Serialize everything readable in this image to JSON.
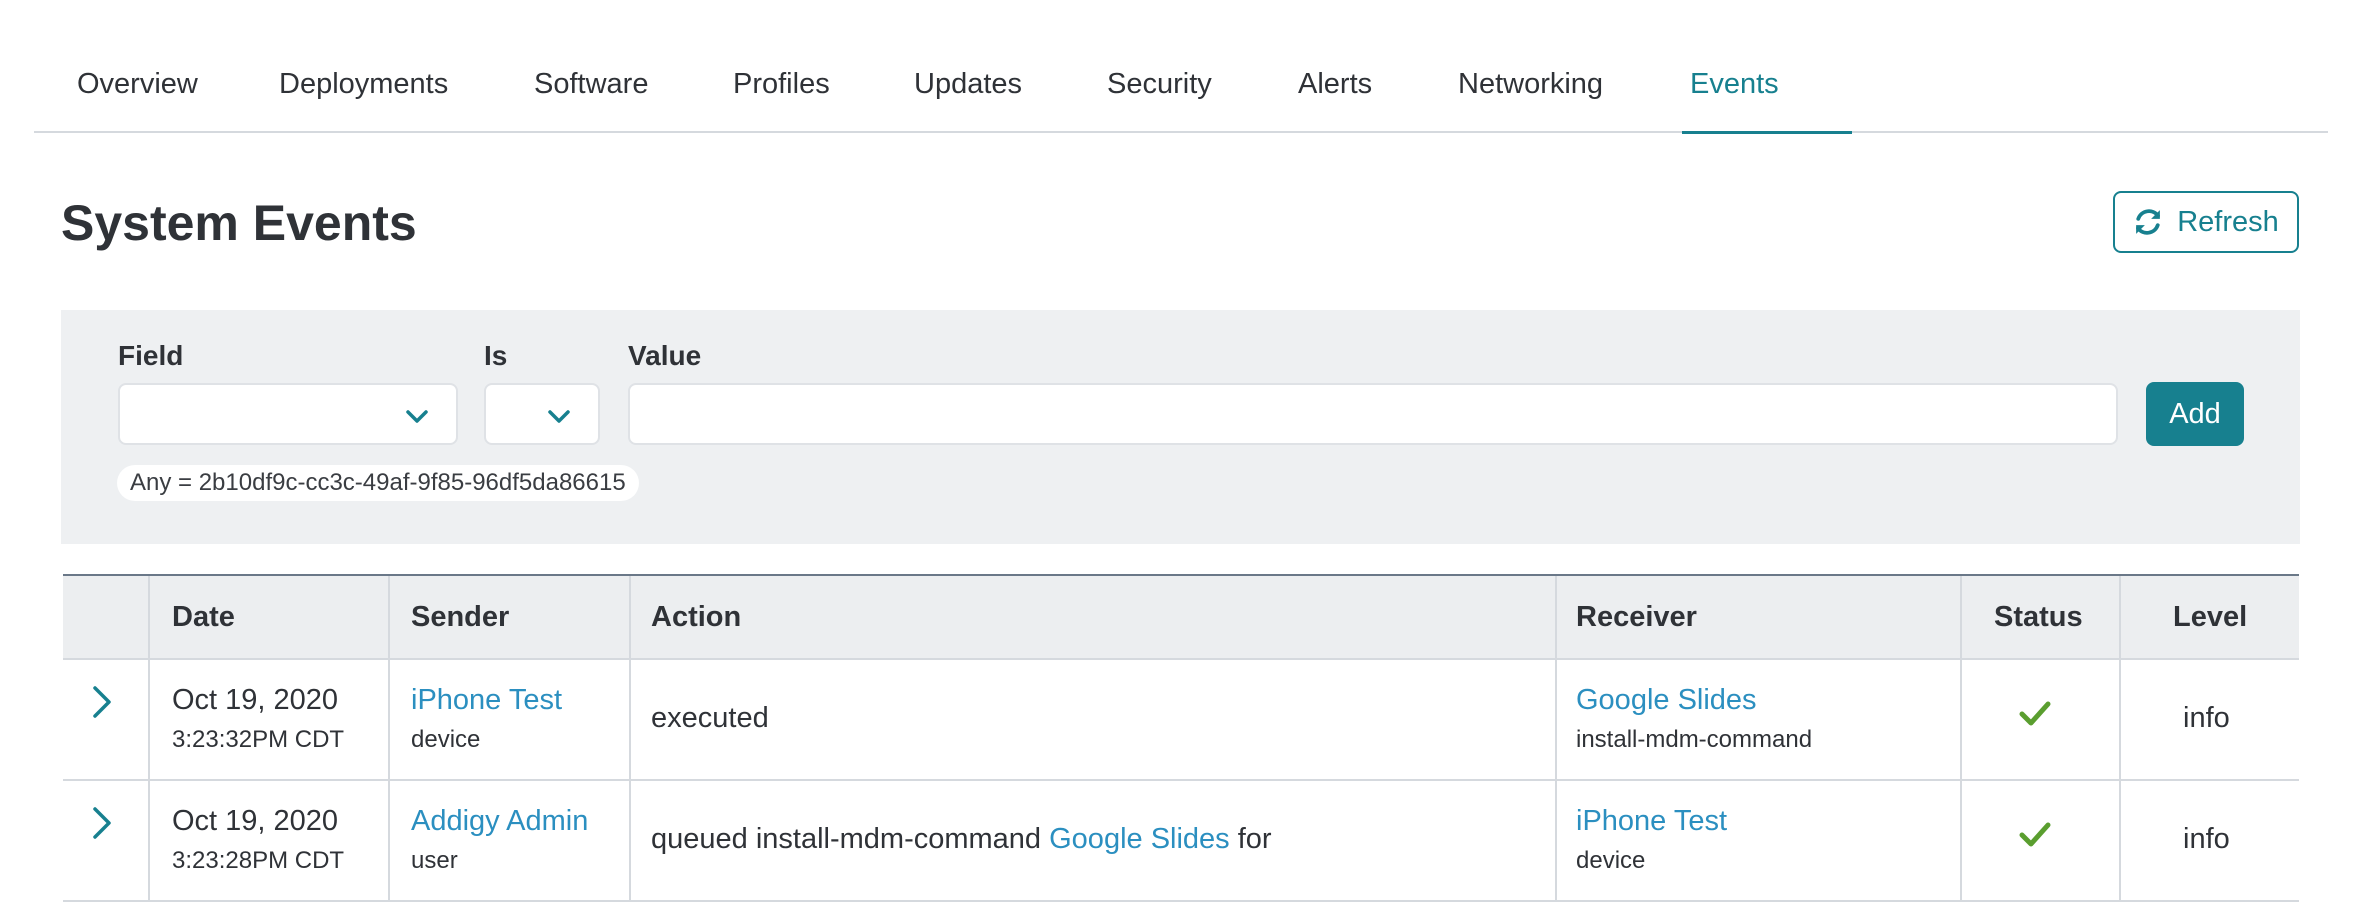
{
  "tabs": [
    {
      "label": "Overview"
    },
    {
      "label": "Deployments"
    },
    {
      "label": "Software"
    },
    {
      "label": "Profiles"
    },
    {
      "label": "Updates"
    },
    {
      "label": "Security"
    },
    {
      "label": "Alerts"
    },
    {
      "label": "Networking"
    },
    {
      "label": "Events",
      "active": true
    }
  ],
  "header": {
    "title": "System Events",
    "refresh_label": "Refresh"
  },
  "filter": {
    "field_label": "Field",
    "is_label": "Is",
    "value_label": "Value",
    "field_value": "",
    "is_value": "",
    "value_input": "",
    "add_label": "Add",
    "active_filter": "Any = 2b10df9c-cc3c-49af-9f85-96df5da86615"
  },
  "table": {
    "columns": [
      "Date",
      "Sender",
      "Action",
      "Receiver",
      "Status",
      "Level"
    ],
    "rows": [
      {
        "date": "Oct 19, 2020",
        "time": "3:23:32PM CDT",
        "sender": "iPhone Test",
        "sender_type": "device",
        "action_text": "executed",
        "receiver": "Google Slides",
        "receiver_type": "install-mdm-command",
        "status": "success",
        "level": "info"
      },
      {
        "date": "Oct 19, 2020",
        "time": "3:23:28PM CDT",
        "sender": "Addigy Admin",
        "sender_type": "user",
        "action_prefix": "queued install-mdm-command",
        "action_link": "Google Slides",
        "action_suffix": "for",
        "receiver": "iPhone Test",
        "receiver_type": "device",
        "status": "success",
        "level": "info"
      }
    ]
  },
  "colors": {
    "accent": "#17808f",
    "link": "#2b8fc0",
    "success": "#5a9e2f",
    "panel": "#eef0f2"
  }
}
